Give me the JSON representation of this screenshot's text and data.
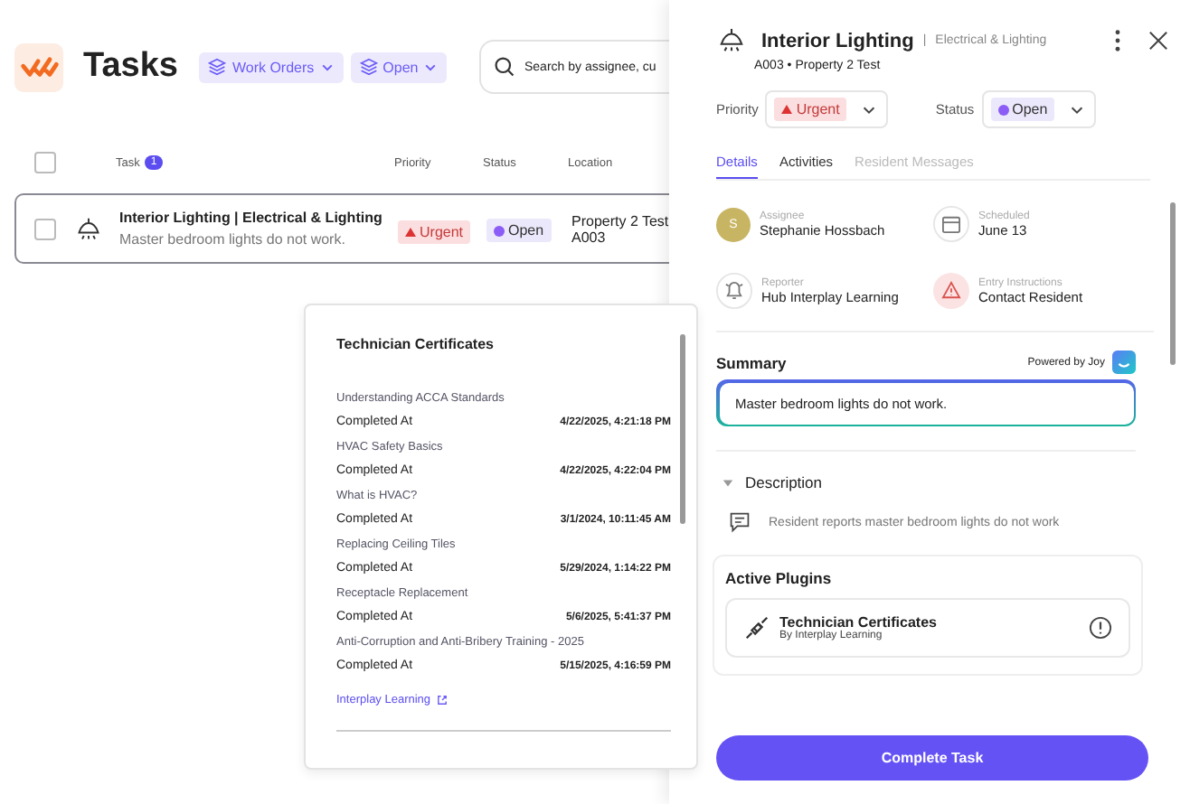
{
  "app": {
    "title": "Tasks",
    "filters": [
      {
        "label": "Work Orders"
      },
      {
        "label": "Open"
      }
    ],
    "search": {
      "placeholder": "Search by assignee, cu"
    }
  },
  "table": {
    "columns": [
      "Task",
      "Priority",
      "Status",
      "Location"
    ],
    "task_count": "1",
    "all_checked": false,
    "rows": [
      {
        "checked": false,
        "selected": true,
        "title": "Interior Lighting | Electrical & Lighting",
        "description": "Master bedroom lights do not work.",
        "priority": "Urgent",
        "status": "Open",
        "location": [
          "Property 2 Test",
          "A003"
        ]
      }
    ]
  },
  "popup": {
    "title": "Technician Certificates",
    "certificates": [
      {
        "name": "Understanding ACCA Standards",
        "label": "Completed At",
        "date": "4/22/2025, 4:21:18 PM"
      },
      {
        "name": "HVAC Safety Basics",
        "label": "Completed At",
        "date": "4/22/2025, 4:22:04 PM"
      },
      {
        "name": "What is HVAC?",
        "label": "Completed At",
        "date": "3/1/2024, 10:11:45 AM"
      },
      {
        "name": "Replacing Ceiling Tiles",
        "label": "Completed At",
        "date": "5/29/2024, 1:14:22 PM"
      },
      {
        "name": "Receptacle Replacement",
        "label": "Completed At",
        "date": "5/6/2025, 5:41:37 PM"
      },
      {
        "name": "Anti-Corruption and Anti-Bribery Training - 2025",
        "label": "Completed At",
        "date": "5/15/2025, 4:16:59 PM"
      }
    ],
    "link": "Interplay Learning"
  },
  "panel": {
    "title": "Interior Lighting",
    "separator": "|",
    "category": "Electrical & Lighting",
    "subtitle": "A003 • Property 2 Test",
    "priority": {
      "label": "Priority",
      "value": "Urgent"
    },
    "status": {
      "label": "Status",
      "value": "Open"
    },
    "tabs": [
      {
        "label": "Details",
        "selected": true,
        "disabled": false
      },
      {
        "label": "Activities",
        "selected": false,
        "disabled": false
      },
      {
        "label": "Resident Messages",
        "selected": false,
        "disabled": true
      }
    ],
    "fields": [
      {
        "kind": "avatar",
        "initial": "S",
        "label": "Assignee",
        "value": "Stephanie Hossbach"
      },
      {
        "kind": "calendar",
        "label": "Scheduled",
        "value": "June 13"
      },
      {
        "kind": "bell",
        "label": "Reporter",
        "value": "Hub Interplay Learning"
      },
      {
        "kind": "warning",
        "label": "Entry Instructions",
        "value": "Contact Resident"
      }
    ],
    "summary": {
      "title": "Summary",
      "powered_by": "Powered by Joy",
      "text": "Master bedroom lights do not work."
    },
    "description": {
      "title": "Description",
      "expanded": true,
      "text": "Resident reports master bedroom lights do not work"
    },
    "plugins": {
      "title": "Active Plugins",
      "items": [
        {
          "name": "Technician Certificates",
          "by": "By Interplay Learning"
        }
      ]
    },
    "complete_button": "Complete Task"
  }
}
